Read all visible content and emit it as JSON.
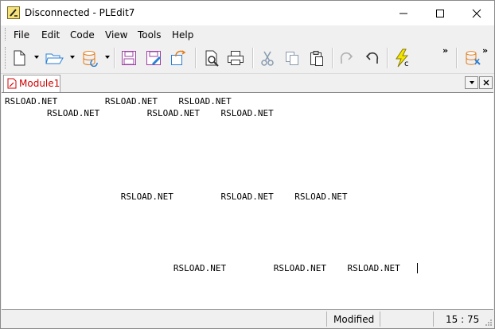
{
  "window": {
    "title": "Disconnected - PLEdit7"
  },
  "menu": [
    "File",
    "Edit",
    "Code",
    "View",
    "Tools",
    "Help"
  ],
  "toolbar": {
    "buttons": [
      "new-document",
      "open-folder",
      "database",
      "save",
      "save-as",
      "save-all",
      "print-preview",
      "print",
      "cut",
      "copy",
      "paste",
      "redo",
      "undo",
      "execute-code",
      "configure-database"
    ],
    "overflow_label": "»"
  },
  "tabs": [
    {
      "label": "Module1",
      "active": true,
      "color": "#d00000"
    }
  ],
  "editor": {
    "lines": [
      "RSLOAD.NET         RSLOAD.NET    RSLOAD.NET",
      "        RSLOAD.NET         RSLOAD.NET    RSLOAD.NET",
      "",
      "",
      "",
      "",
      "",
      "",
      "                      RSLOAD.NET         RSLOAD.NET    RSLOAD.NET",
      "",
      "",
      "",
      "",
      "",
      "",
      "",
      "",
      "                                RSLOAD.NET         RSLOAD.NET    RSLOAD.NET"
    ]
  },
  "status": {
    "state": "Modified",
    "position": "15 : 75"
  }
}
